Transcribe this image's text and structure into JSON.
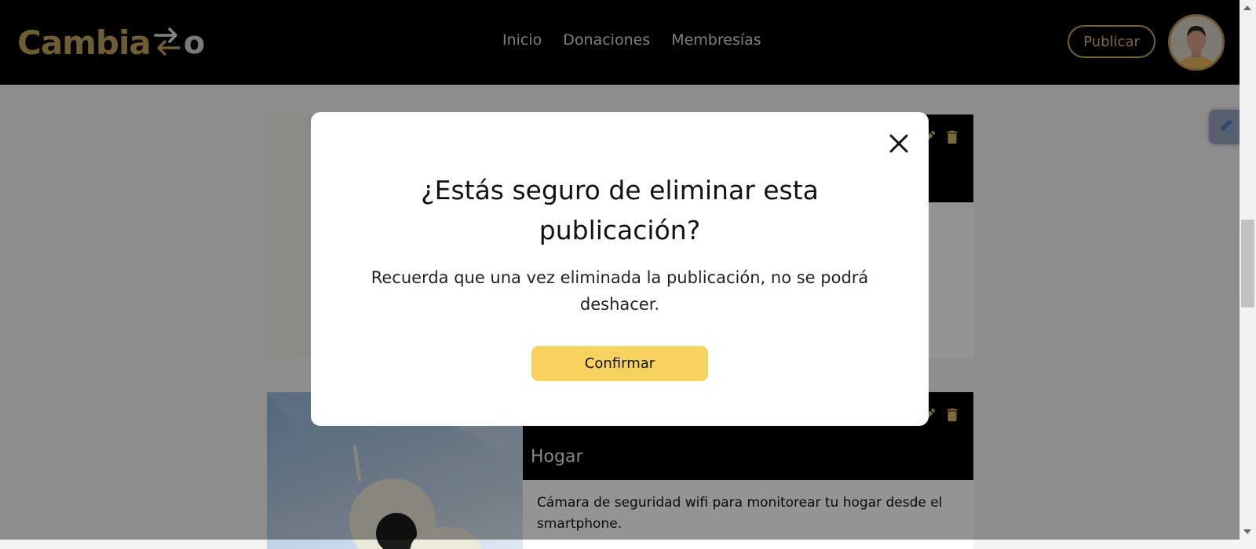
{
  "navbar": {
    "logo_text": "Cambia",
    "logo_tail": "o",
    "links": [
      "Inicio",
      "Donaciones",
      "Membresías"
    ],
    "publish_label": "Publicar"
  },
  "cards": [
    {
      "category": "",
      "description": ""
    },
    {
      "category": "Hogar",
      "description": "Cámara de seguridad wifi para monitorear tu hogar desde el smartphone."
    }
  ],
  "modal": {
    "title": "¿Estás seguro de eliminar esta publicación?",
    "text": "Recuerda que una vez eliminada la publicación, no se podrá deshacer.",
    "confirm_label": "Confirmar"
  },
  "colors": {
    "accent": "#f7d25f",
    "brand_gold": "#bfa05a",
    "navbar_bg": "#000000"
  },
  "icons": [
    "close-icon",
    "pencil-icon",
    "trash-icon",
    "swap-arrows-icon",
    "floating-tool-icon"
  ]
}
